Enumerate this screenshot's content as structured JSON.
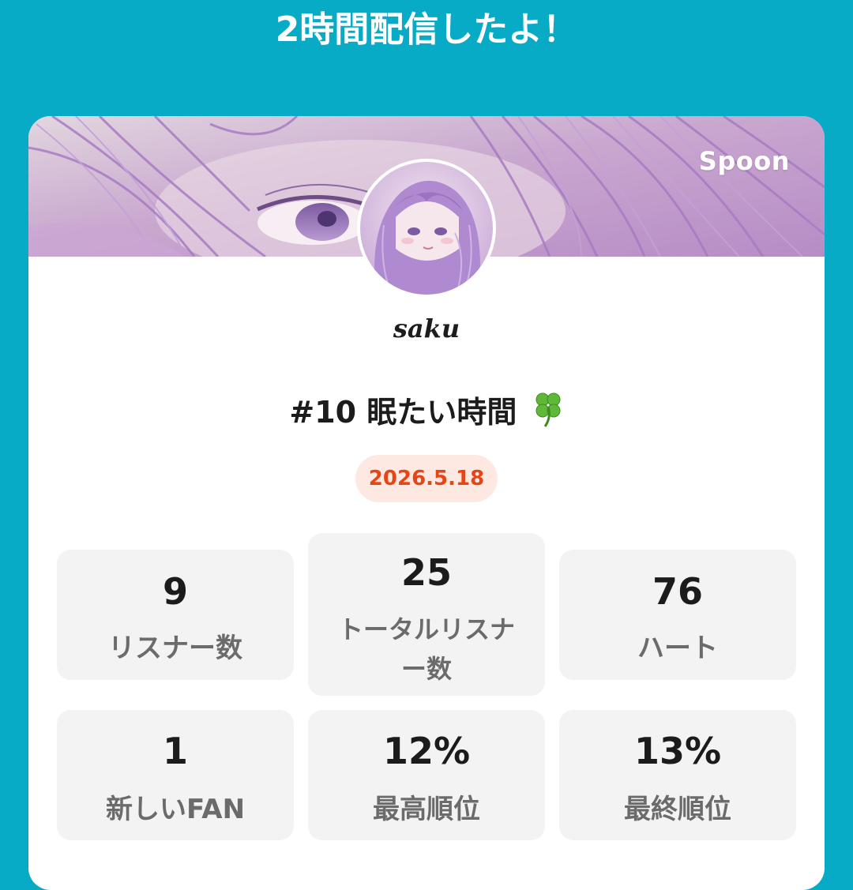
{
  "headline": "2時間配信したよ！",
  "brand": "Spoon",
  "username": "saku",
  "broadcast_title": "#10 眠たい時間",
  "title_emoji": "🍀",
  "date": "2026.5.18",
  "stats": [
    {
      "value": "9",
      "label": "リスナー数"
    },
    {
      "value": "25",
      "label": "トータルリスナー数"
    },
    {
      "value": "76",
      "label": "ハート"
    },
    {
      "value": "1",
      "label": "新しいFAN"
    },
    {
      "value": "12%",
      "label": "最高順位"
    },
    {
      "value": "13%",
      "label": "最終順位"
    }
  ],
  "colors": {
    "background": "#07abc6",
    "card": "#ffffff",
    "stat_tile": "#f3f3f3",
    "date_text": "#e64516",
    "date_bg": "#fde8e2"
  },
  "icons": {
    "avatar": "profile-avatar",
    "title_emoji": "four-leaf-clover"
  }
}
